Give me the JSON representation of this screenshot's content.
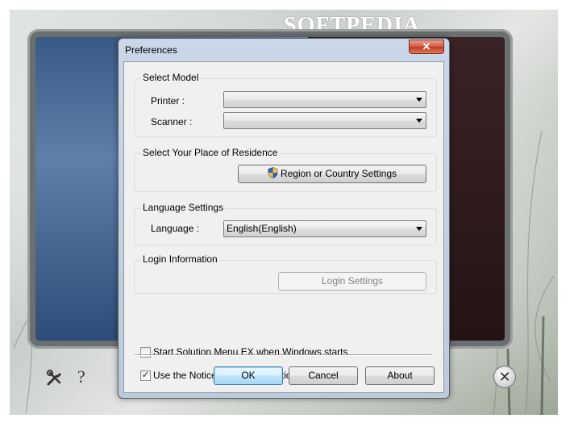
{
  "background_app": {
    "logo_text": "SOFTPEDIA",
    "icons": [
      "tools-icon",
      "help-icon",
      "close-icon"
    ]
  },
  "dialog": {
    "title": "Preferences",
    "close_glyph": "✕",
    "select_model": {
      "title": "Select Model",
      "printer_label": "Printer :",
      "printer_value": "",
      "scanner_label": "Scanner :",
      "scanner_value": ""
    },
    "residence": {
      "title": "Select Your Place of Residence",
      "button_label": "Region or Country Settings",
      "button_icon": "uac-shield-icon"
    },
    "language": {
      "title": "Language Settings",
      "label": "Language :",
      "value": "English(English)"
    },
    "login": {
      "title": "Login Information",
      "button_label": "Login Settings"
    },
    "options": {
      "start_with_windows": {
        "label": "Start Solution Menu EX when Windows starts",
        "checked": false
      },
      "notices_updates": {
        "label": "Use the Notices/Updates function",
        "checked": true
      }
    },
    "buttons": {
      "ok": "OK",
      "cancel": "Cancel",
      "about": "About"
    }
  },
  "colors": {
    "close_button": "#c84a30",
    "dialog_frame": "#c3d2e2",
    "client_bg": "#f0f0f0"
  }
}
